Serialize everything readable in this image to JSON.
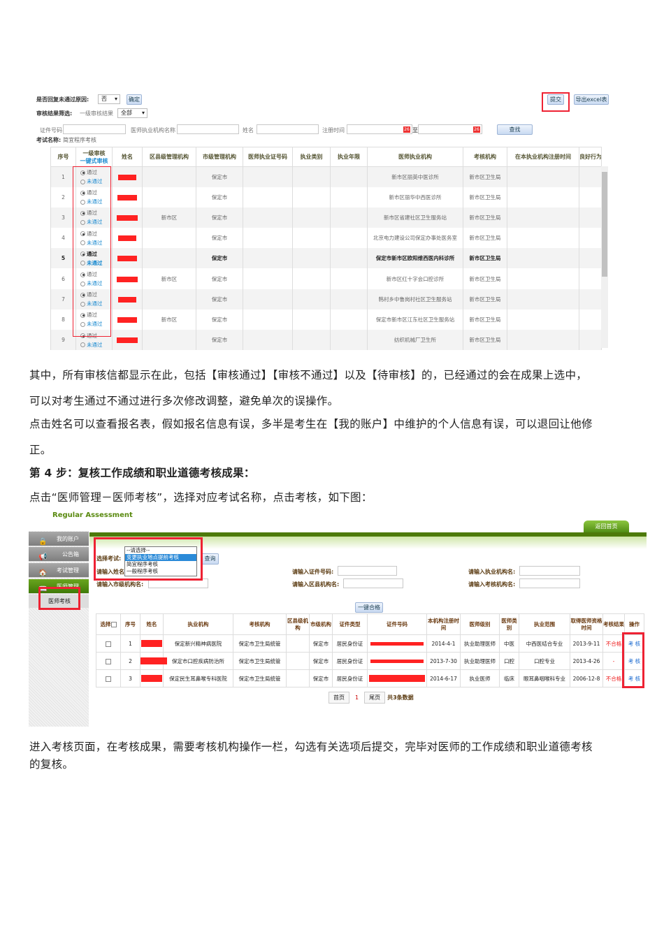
{
  "screenshot1": {
    "reply_reason_label": "是否回复未通过原因:",
    "reply_reason_value": "否",
    "confirm_button": "确定",
    "submit_button": "提交",
    "export_button": "导出excel表",
    "filter_label": "审核结果筛选:",
    "filter_sublabel": "一级审核结果",
    "filter_value": "全部",
    "cert_label": "证件号码",
    "org_label": "医师执业机构名称",
    "name_label": "姓名",
    "reg_time_label": "注册时间",
    "to_label": "至",
    "calendar_icon_text": "26",
    "search_button": "查找",
    "exam_name_label": "考试名称:",
    "exam_name_value": "简宜程序考核",
    "columns": [
      "序号",
      "一级审核",
      "一键式审核",
      "姓名",
      "区县级管理机构",
      "市级管理机构",
      "医师执业证号码",
      "执业类别",
      "执业年限",
      "医师执业机构",
      "考核机构",
      "在本执业机构注册时间",
      "良好行为"
    ],
    "pass_label": "通过",
    "fail_label": "未通过",
    "rows": [
      {
        "no": "1",
        "county": "",
        "city": "保定市",
        "org": "新市区丽英中医诊所",
        "assess": "新市区卫生局"
      },
      {
        "no": "2",
        "county": "",
        "city": "保定市",
        "org": "新市区丽华中西医诊所",
        "assess": "新市区卫生局"
      },
      {
        "no": "3",
        "county": "新市区",
        "city": "保定市",
        "org": "新市区省建社区卫生服务站",
        "assess": "新市区卫生局"
      },
      {
        "no": "4",
        "county": "",
        "city": "保定市",
        "org": "北京电力建设公司保定办事处医务室",
        "assess": "新市区卫生局"
      },
      {
        "no": "5",
        "county": "",
        "city": "保定市",
        "org": "保定市新市区欧阳维西医内科诊所",
        "assess": "新市区卫生局"
      },
      {
        "no": "6",
        "county": "新市区",
        "city": "保定市",
        "org": "新市区红十字会口腔诊所",
        "assess": "新市区卫生局"
      },
      {
        "no": "7",
        "county": "",
        "city": "保定市",
        "org": "韩村乡中鲁岗村社区卫生服务站",
        "assess": "新市区卫生局"
      },
      {
        "no": "8",
        "county": "新市区",
        "city": "保定市",
        "org": "保定市新市区江东社区卫生服务站",
        "assess": "新市区卫生局"
      },
      {
        "no": "9",
        "county": "",
        "city": "保定市",
        "org": "纺织机械厂卫生所",
        "assess": "新市区卫生局"
      }
    ]
  },
  "paragraphs": {
    "p1": "其中，所有审核信都显示在此，包括【审核通过】【审核不通过】以及【待审核】的，已经通过的会在成果上选中，",
    "p2": "可以对考生通过不通过进行多次修改调整，避免单次的误操作。",
    "p3": "点击姓名可以查看报名表，假如报名信息有误，多半是考生在【我的账户】中维护的个人信息有误，可以退回让他修",
    "p4": "正。",
    "heading": "第 4 步：复核工作成绩和职业道德考核成果：",
    "p5": "点击“医师管理－医师考核”，选择对应考试名称，点击考核，如下图：",
    "p6": "进入考核页面，在考核成果，需要考核机构操作一栏，勾选有关选项后提交，完毕对医师的工作成绩和职业道德考核",
    "p7": "的复核。"
  },
  "screenshot2": {
    "brand": "Regular Assessment",
    "home_tab": "返回首页",
    "sidebar": [
      {
        "label": "我的账户",
        "icon": "lock-icon"
      },
      {
        "label": "公告箱",
        "icon": "megaphone-icon"
      },
      {
        "label": "考试管理",
        "icon": "house-icon"
      },
      {
        "label": "医师管理",
        "icon": "book-icon"
      },
      {
        "label": "医师考核",
        "icon": ""
      }
    ],
    "select_exam_label": "选择考试:",
    "exam_options": [
      "--请选择--",
      "变更执业地点提前考核",
      "简宜程序考核",
      "一般程序考核"
    ],
    "query_button": "查询",
    "name_input_label": "请输入姓名:",
    "city_org_label": "请输入市级机构名:",
    "cert_label": "请输入证件号码:",
    "county_org_label": "请输入区县机构名:",
    "practice_org_label": "请输入执业机构名:",
    "assess_org_label": "请输入考核机构名:",
    "one_click_pass": "一键合格",
    "columns": [
      "选择",
      "序号",
      "姓名",
      "执业机构",
      "考核机构",
      "区县级机构",
      "市级机构",
      "证件类型",
      "证件号码",
      "本机构注册时间",
      "医师级别",
      "医师类别",
      "执业范围",
      "取得医师资格时间",
      "考核结果",
      "操作"
    ],
    "rows": [
      {
        "no": "1",
        "org": "保定新兴精神病医院",
        "assess": "保定市卫生局统管",
        "county": "",
        "city": "保定市",
        "cert_type": "居民身份证",
        "reg": "2014-4-1",
        "level": "执业助理医师",
        "type": "中医",
        "scope": "中西医结合专业",
        "qual": "2013-9-11",
        "result": "不合格",
        "action": "考 核"
      },
      {
        "no": "2",
        "org": "保定市口腔疾病防治所",
        "assess": "保定市卫生局统管",
        "county": "",
        "city": "保定市",
        "cert_type": "居民身份证",
        "reg": "2013-7-30",
        "level": "执业助理医师",
        "type": "口腔",
        "scope": "口腔专业",
        "qual": "2013-4-26",
        "result": "-",
        "action": "考 核"
      },
      {
        "no": "3",
        "org": "保定民生耳鼻喉专科医院",
        "assess": "保定市卫生局统管",
        "county": "",
        "city": "保定市",
        "cert_type": "居民身份证",
        "reg": "2014-6-17",
        "level": "执业医师",
        "type": "临床",
        "scope": "眼耳鼻咽喉科专业",
        "qual": "2006-12-8",
        "result": "不合格",
        "action": "考 核"
      }
    ],
    "pager": {
      "first": "首页",
      "current": "1",
      "last": "尾页",
      "total": "共3条数据"
    }
  },
  "colors": {
    "accent_red": "#ee2222",
    "green": "#5a8a10",
    "link_blue": "#1a6ad0"
  }
}
